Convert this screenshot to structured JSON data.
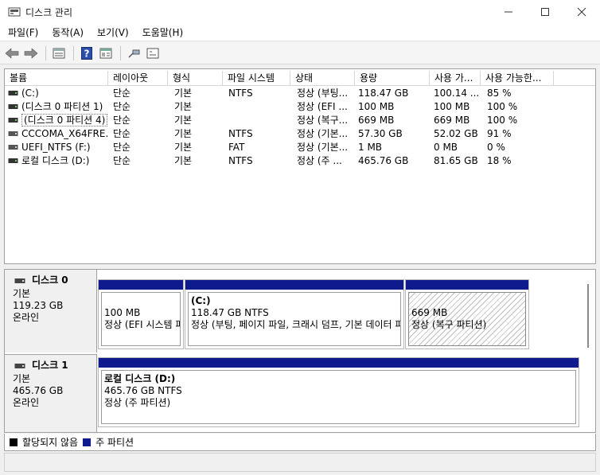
{
  "window": {
    "title": "디스크 관리",
    "controls": [
      "minimize-icon",
      "maximize-icon",
      "close-icon"
    ]
  },
  "menu": [
    "파일(F)",
    "동작(A)",
    "보기(V)",
    "도움말(H)"
  ],
  "toolbar": {
    "icons": [
      "back-arrow-icon",
      "forward-arrow-icon",
      "properties-icon",
      "help-icon",
      "view-pane-icon",
      "connect-disk-icon",
      "rescan-disks-icon"
    ]
  },
  "volume_list": {
    "columns": [
      "볼륨",
      "레이아웃",
      "형식",
      "파일 시스템",
      "상태",
      "용량",
      "사용 가...",
      "사용 가능한..."
    ],
    "rows": [
      [
        "(C:)",
        "단순",
        "기본",
        "NTFS",
        "정상 (부팅...",
        "118.47 GB",
        "100.14 ...",
        "85 %"
      ],
      [
        "(디스크 0 파티션 1)",
        "단순",
        "기본",
        "",
        "정상 (EFI ...",
        "100 MB",
        "100 MB",
        "100 %"
      ],
      [
        "(디스크 0 파티션 4)",
        "단순",
        "기본",
        "",
        "정상 (복구...",
        "669 MB",
        "669 MB",
        "100 %"
      ],
      [
        "CCCOMA_X64FRE...",
        "단순",
        "기본",
        "NTFS",
        "정상 (기본...",
        "57.30 GB",
        "52.02 GB",
        "91 %"
      ],
      [
        "UEFI_NTFS (F:)",
        "단순",
        "기본",
        "FAT",
        "정상 (기본...",
        "1 MB",
        "0 MB",
        "0 %"
      ],
      [
        "로컬 디스크 (D:)",
        "단순",
        "기본",
        "NTFS",
        "정상 (주 ...",
        "465.76 GB",
        "81.65 GB",
        "18 %"
      ]
    ]
  },
  "disks": [
    {
      "name": "디스크 0",
      "type": "기본",
      "size": "119.23 GB",
      "status": "온라인",
      "partitions": [
        {
          "name": "",
          "size": "100 MB",
          "status": "정상 (EFI 시스템 파티션)"
        },
        {
          "name": "(C:)",
          "size": "118.47 GB NTFS",
          "status": "정상 (부팅, 페이지 파일, 크래시 덤프, 기본 데이터 파티션)"
        },
        {
          "name": "",
          "size": "669 MB",
          "status": "정상 (복구 파티션)"
        }
      ]
    },
    {
      "name": "디스크 1",
      "type": "기본",
      "size": "465.76 GB",
      "status": "온라인",
      "partitions": [
        {
          "name": "로컬 디스크  (D:)",
          "size": "465.76 GB NTFS",
          "status": "정상 (주 파티션)"
        }
      ]
    }
  ],
  "legend": [
    {
      "label": "할당되지 않음",
      "color": "#000000"
    },
    {
      "label": "주 파티션",
      "color": "#0f1a8f"
    }
  ],
  "colors": {
    "primary_partition": "#0f1a8f",
    "unallocated": "#000000"
  }
}
